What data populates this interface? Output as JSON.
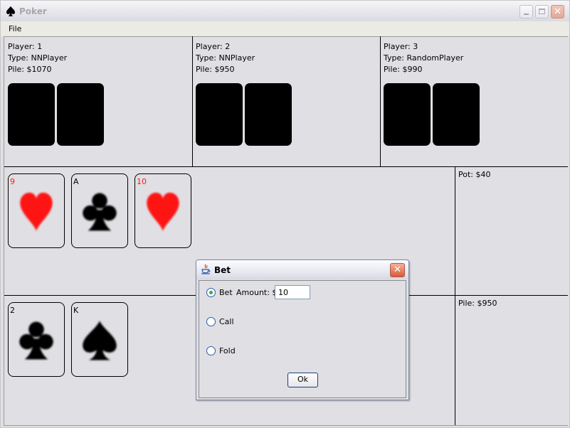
{
  "window": {
    "title": "Poker",
    "title_icon": "spade-icon",
    "controls": [
      "minimize",
      "maximize",
      "close"
    ]
  },
  "menu": {
    "file_label": "File"
  },
  "players": [
    {
      "player": "Player: 1",
      "type": "Type: NNPlayer",
      "pile": "Pile: $1070"
    },
    {
      "player": "Player: 2",
      "type": "Type: NNPlayer",
      "pile": "Pile: $950"
    },
    {
      "player": "Player: 3",
      "type": "Type: RandomPlayer",
      "pile": "Pile: $990"
    }
  ],
  "community_cards": [
    {
      "rank": "9",
      "suit": "heart-icon",
      "color": "#ff1a1a"
    },
    {
      "rank": "A",
      "suit": "club-icon",
      "color": "#000000"
    },
    {
      "rank": "10",
      "suit": "heart-icon",
      "color": "#ff1a1a"
    }
  ],
  "pot_label": "Pot: $40",
  "hand_cards": [
    {
      "rank": "2",
      "suit": "club-icon",
      "color": "#000000"
    },
    {
      "rank": "K",
      "suit": "spade-icon",
      "color": "#000000"
    }
  ],
  "my_pile_label": "Pile: $950",
  "bet_dialog": {
    "title": "Bet",
    "title_icon": "java-cup-icon",
    "bet_label": "Bet",
    "amount_label": "Amount: $",
    "amount_value": "10",
    "call_label": "Call",
    "fold_label": "Fold",
    "ok_label": "Ok",
    "selected_option": "Bet"
  }
}
